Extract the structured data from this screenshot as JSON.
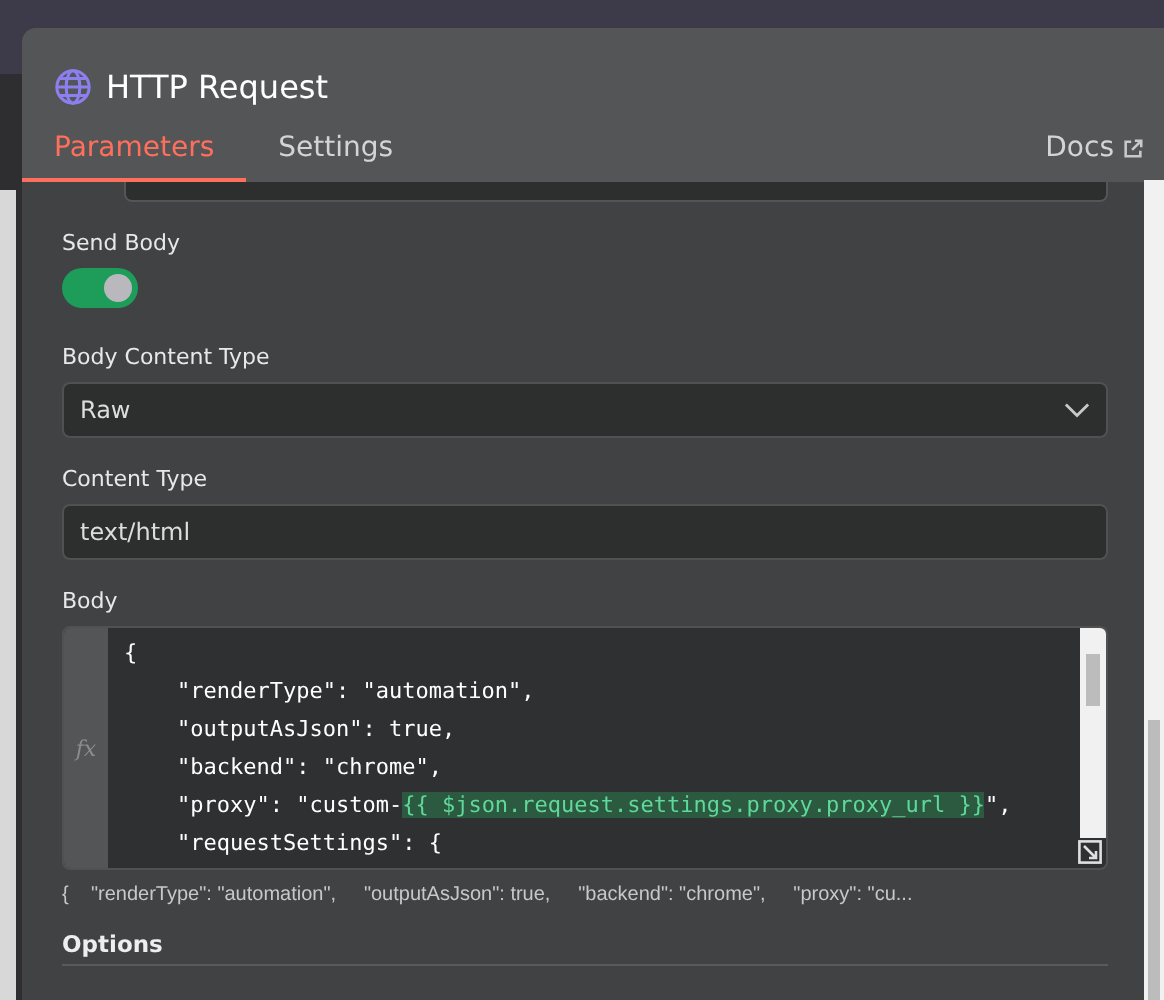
{
  "node": {
    "title": "HTTP Request"
  },
  "tabs": [
    {
      "label": "Parameters",
      "selected": true
    },
    {
      "label": "Settings",
      "selected": false
    }
  ],
  "docs_link": "Docs",
  "fields": [
    {
      "kind": "toggle",
      "label": "Send Body",
      "on": true
    },
    {
      "kind": "select",
      "label": "Body Content Type",
      "value": "Raw"
    },
    {
      "kind": "input",
      "label": "Content Type",
      "value": "text/html"
    },
    {
      "kind": "code",
      "label": "Body",
      "expression_marker": "fx",
      "lines": [
        [
          {
            "text": "{"
          }
        ],
        [
          {
            "text": "    \"renderType\": \"automation\","
          }
        ],
        [
          {
            "text": "    \"outputAsJson\": true,"
          }
        ],
        [
          {
            "text": "    \"backend\": \"chrome\","
          }
        ],
        [
          {
            "text": "    \"proxy\": \"custom-"
          },
          {
            "text": "{{ $json.request.settings.proxy.proxy_url }}",
            "kind": "expression"
          },
          {
            "text": "\","
          }
        ],
        [
          {
            "text": "    \"requestSettings\": {"
          }
        ]
      ],
      "preview": "{    \"renderType\": \"automation\",     \"outputAsJson\": true,     \"backend\": \"chrome\",     \"proxy\": \"cu..."
    }
  ],
  "section": "Options"
}
